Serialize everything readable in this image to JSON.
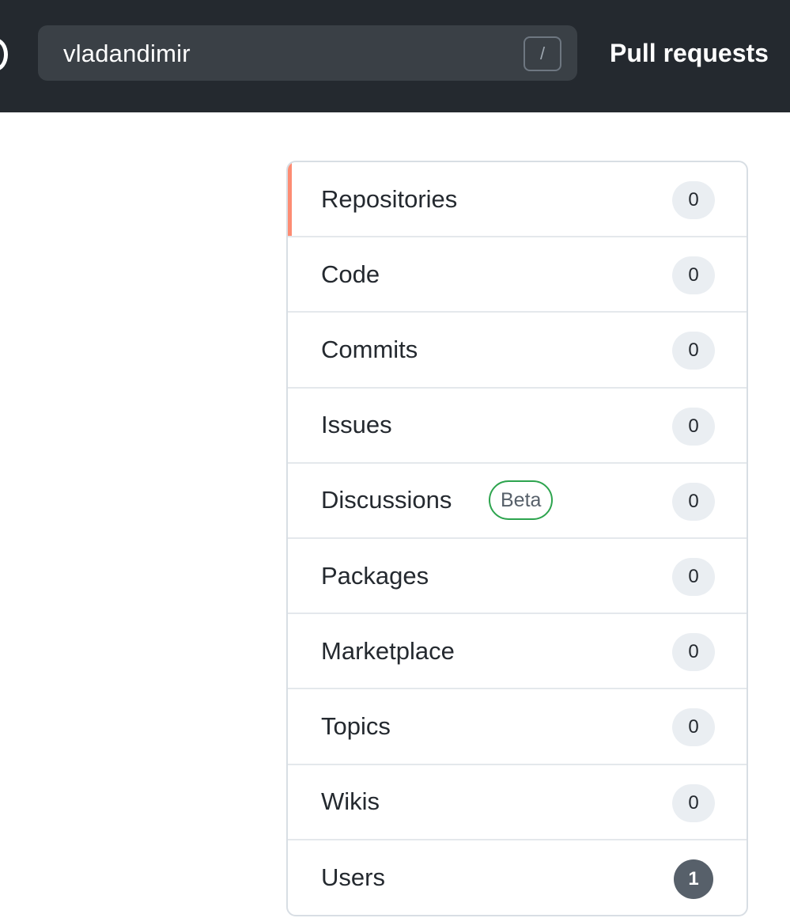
{
  "header": {
    "search_value": "vladandimir",
    "search_shortcut": "/",
    "nav_link": "Pull requests"
  },
  "colors": {
    "header_bg": "#24292f",
    "selected_indicator": "#fd8c73",
    "beta_border": "#2da44e",
    "active_count_bg": "#57606a"
  },
  "menu": {
    "items": [
      {
        "label": "Repositories",
        "count": "0",
        "selected": true
      },
      {
        "label": "Code",
        "count": "0"
      },
      {
        "label": "Commits",
        "count": "0"
      },
      {
        "label": "Issues",
        "count": "0"
      },
      {
        "label": "Discussions",
        "badge": "Beta",
        "count": "0"
      },
      {
        "label": "Packages",
        "count": "0"
      },
      {
        "label": "Marketplace",
        "count": "0"
      },
      {
        "label": "Topics",
        "count": "0"
      },
      {
        "label": "Wikis",
        "count": "0"
      },
      {
        "label": "Users",
        "count": "1",
        "active": true
      }
    ]
  }
}
